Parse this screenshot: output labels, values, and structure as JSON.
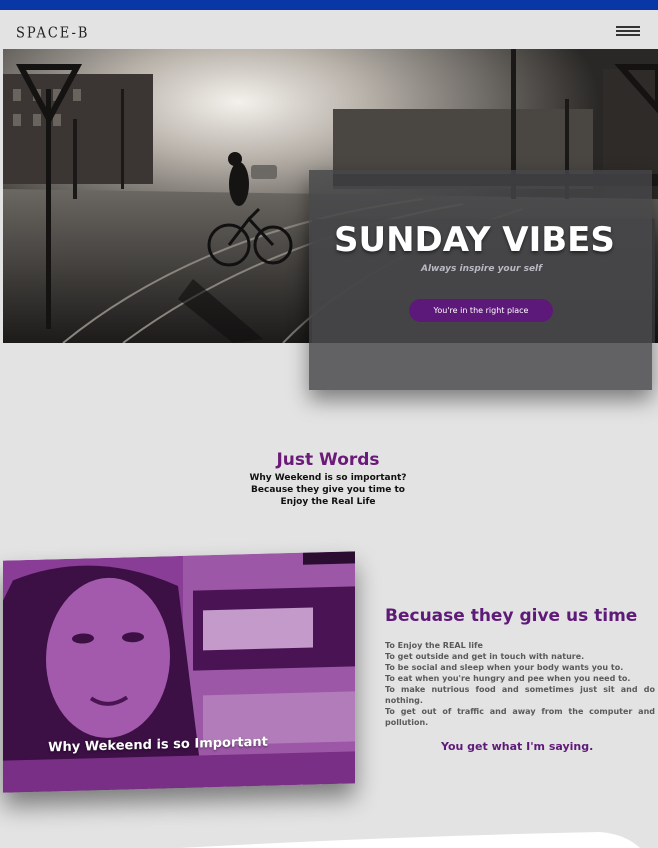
{
  "header": {
    "logo": "SPACE-B",
    "menu_icon": "hamburger-icon",
    "accent": "#0a37a6"
  },
  "hero": {
    "title": "SUNDAY VIBES",
    "subtitle": "Always inspire your self",
    "cta_label": "You're in the right place",
    "cta_color": "#5d1979"
  },
  "intro": {
    "title": "Just Words",
    "lines": [
      "Why Weekend is so important?",
      "Because they give you time to",
      "Enjoy the Real Life"
    ]
  },
  "feature": {
    "card_caption": "Why Wekeend is so Important",
    "title": "Becuase they give us time",
    "items": [
      "To Enjoy the REAL life",
      "To get outside and get in touch with nature.",
      "To be social and sleep when your body wants you to.",
      "To eat when you're hungry and pee when you need to.",
      "To make nutrious food and sometimes just sit and do nothing.",
      "To get out of traffic and away from the computer and pollution."
    ],
    "footer": "You get what I'm saying.",
    "accent": "#5e1a78"
  }
}
